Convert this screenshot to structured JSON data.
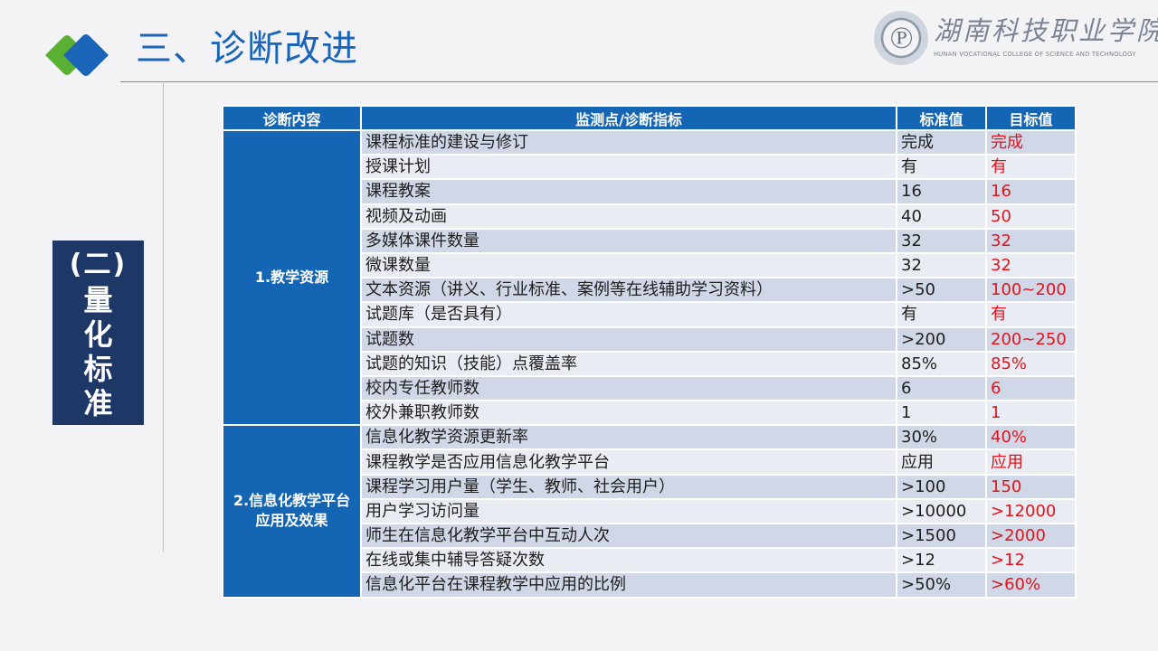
{
  "header": {
    "title": "三、诊断改进"
  },
  "college": {
    "name_cn": "湖南科技职业学院",
    "name_en": "HUNAN VOCATIONAL COLLEGE OF SCIENCE AND TECHNOLOGY",
    "seal_glyph": "℗"
  },
  "section": {
    "number": "(二)",
    "text": "量化标准"
  },
  "colors": {
    "accent_blue": "#1466b5",
    "navy": "#1d3766",
    "target_red": "#e0141c"
  },
  "table": {
    "headers": [
      "诊断内容",
      "监测点/诊断指标",
      "标准值",
      "目标值"
    ],
    "groups": [
      {
        "label": "1.教学资源",
        "rows": [
          {
            "indicator": "课程标准的建设与修订",
            "standard": "完成",
            "target": "完成"
          },
          {
            "indicator": "授课计划",
            "standard": "有",
            "target": "有"
          },
          {
            "indicator": "课程教案",
            "standard": "16",
            "target": "16"
          },
          {
            "indicator": "视频及动画",
            "standard": "40",
            "target": "50"
          },
          {
            "indicator": "多媒体课件数量",
            "standard": "32",
            "target": "32"
          },
          {
            "indicator": "微课数量",
            "standard": "32",
            "target": "32"
          },
          {
            "indicator": "文本资源（讲义、行业标准、案例等在线辅助学习资料）",
            "standard": ">50",
            "target": "100~200"
          },
          {
            "indicator": "试题库（是否具有）",
            "standard": "有",
            "target": "有"
          },
          {
            "indicator": "试题数",
            "standard": ">200",
            "target": "200~250"
          },
          {
            "indicator": "试题的知识（技能）点覆盖率",
            "standard": "85%",
            "target": "85%"
          },
          {
            "indicator": "校内专任教师数",
            "standard": "6",
            "target": "6"
          },
          {
            "indicator": "校外兼职教师数",
            "standard": "1",
            "target": "1"
          }
        ]
      },
      {
        "label": "2.信息化教学平台应用及效果",
        "rows": [
          {
            "indicator": "信息化教学资源更新率",
            "standard": "30%",
            "target": "40%"
          },
          {
            "indicator": "课程教学是否应用信息化教学平台",
            "standard": "应用",
            "target": "应用"
          },
          {
            "indicator": "课程学习用户量（学生、教师、社会用户）",
            "standard": ">100",
            "target": "150"
          },
          {
            "indicator": "用户学习访问量",
            "standard": ">10000",
            "target": ">12000"
          },
          {
            "indicator": "师生在信息化教学平台中互动人次",
            "standard": ">1500",
            "target": ">2000"
          },
          {
            "indicator": "在线或集中辅导答疑次数",
            "standard": ">12",
            "target": ">12"
          },
          {
            "indicator": "信息化平台在课程教学中应用的比例",
            "standard": ">50%",
            "target": ">60%"
          }
        ]
      }
    ]
  }
}
